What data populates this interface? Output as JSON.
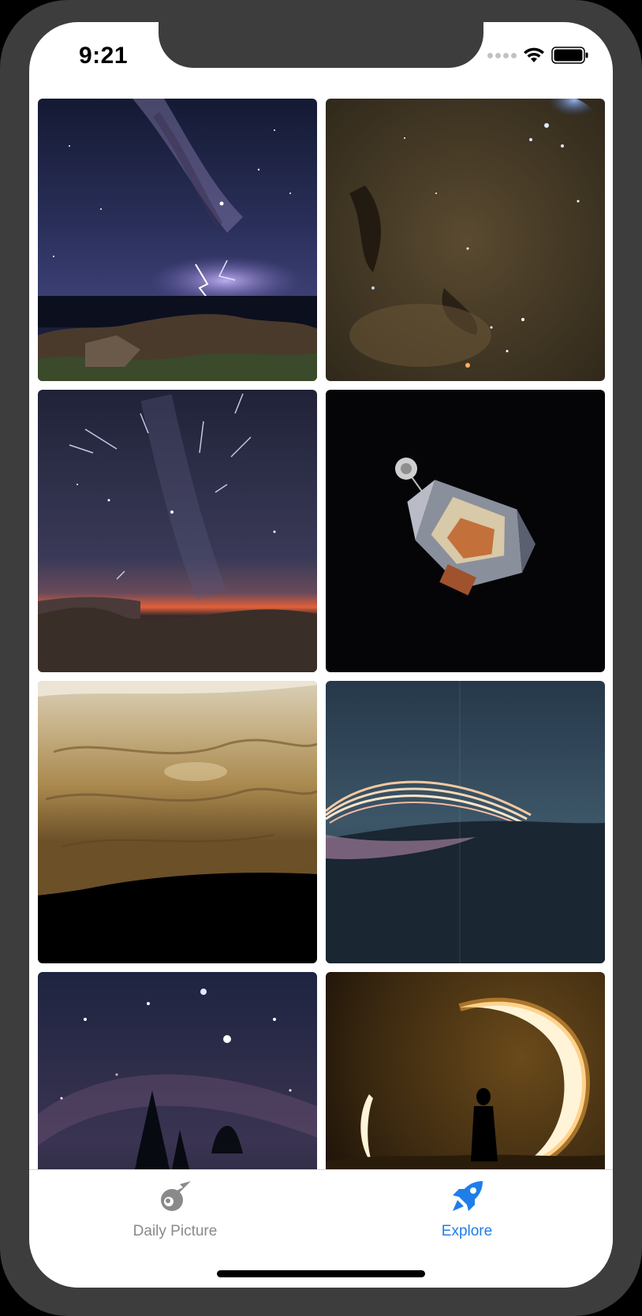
{
  "status_bar": {
    "time": "9:21"
  },
  "gallery": {
    "items": [
      {
        "name": "milky-way-lightning"
      },
      {
        "name": "star-field-nebula"
      },
      {
        "name": "meteor-shower"
      },
      {
        "name": "lunar-module"
      },
      {
        "name": "mars-terrain"
      },
      {
        "name": "sun-trails-arc"
      },
      {
        "name": "winter-milky-way-trees"
      },
      {
        "name": "annular-eclipse-silhouette"
      }
    ]
  },
  "tab_bar": {
    "tabs": [
      {
        "label": "Daily Picture",
        "icon": "meteor-icon",
        "selected": false
      },
      {
        "label": "Explore",
        "icon": "rocket-icon",
        "selected": true
      }
    ],
    "colors": {
      "active": "#1f7ee8",
      "inactive": "#8a8a8a"
    }
  }
}
